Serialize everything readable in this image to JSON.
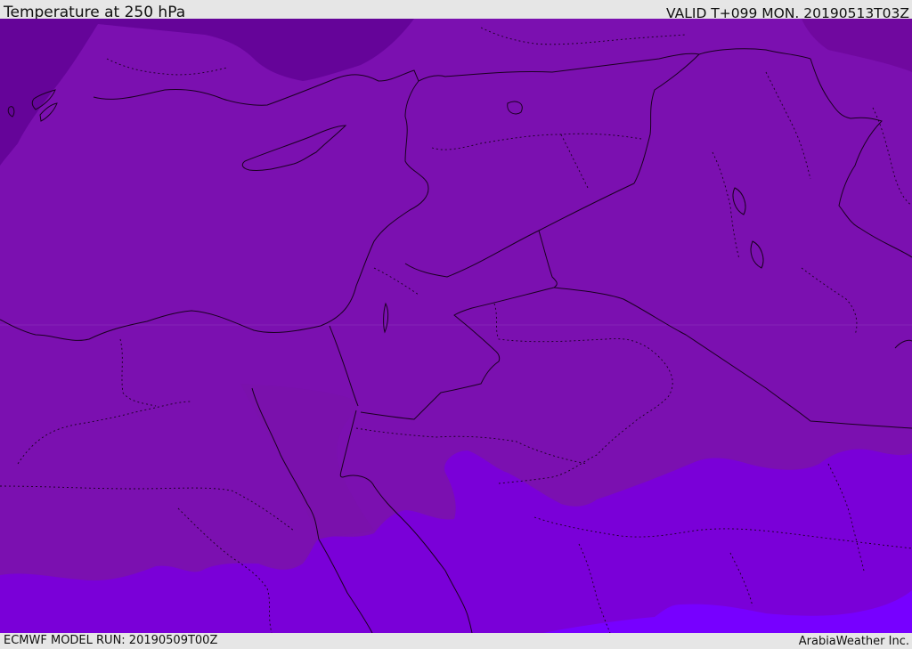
{
  "header": {
    "title": "Temperature at 250 hPa",
    "valid": "VALID T+099 MON. 20190513T03Z"
  },
  "footer": {
    "model_run": "ECMWF MODEL RUN: 20190509T00Z",
    "credit": "ArabiaWeather Inc."
  },
  "colors": {
    "main_fill": "#7b10b0",
    "darker_fill": "#650499",
    "southern_fill": "#7a00d8",
    "brightest_fill": "#7700ff",
    "sinai_fill": "#7a11ac",
    "border_line": "#1a0020"
  }
}
